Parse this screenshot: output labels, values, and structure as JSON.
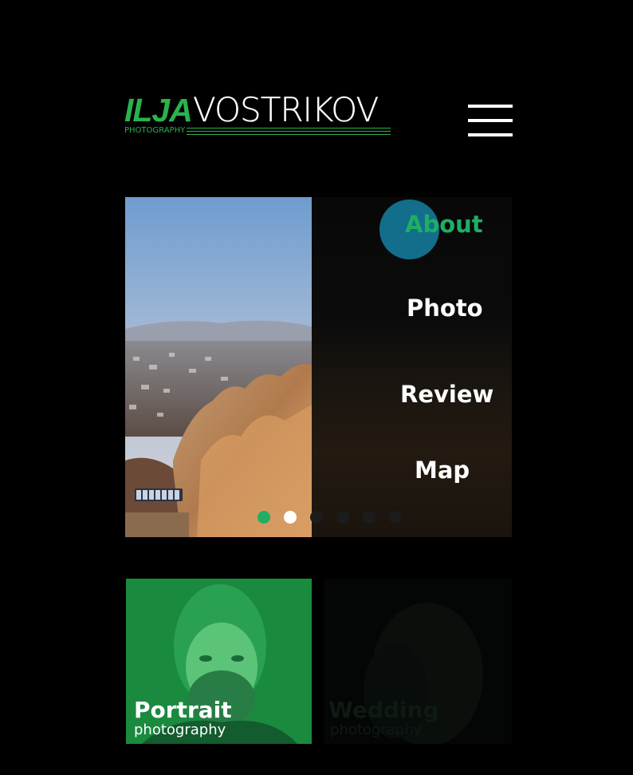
{
  "logo": {
    "first": "ILJA",
    "last": "VOSTRIKOV",
    "tagline": "PHOTOGRAPHY",
    "accent_color": "#2bb24c"
  },
  "header": {
    "menu_icon": "hamburger-menu-icon"
  },
  "hero": {
    "menu": [
      {
        "label": "About",
        "active": true
      },
      {
        "label": "Photo",
        "active": false
      },
      {
        "label": "Review",
        "active": false
      },
      {
        "label": "Map",
        "active": false
      }
    ],
    "active_color": "#1fae64",
    "ripple_color": "#147a9a",
    "slides_total": 6,
    "slide_active": 1
  },
  "tiles": [
    {
      "title": "Portrait",
      "subtitle": "photography",
      "tint": "#1a8a3e"
    },
    {
      "title": "Wedding",
      "subtitle": "photography",
      "tint": "#050807"
    }
  ]
}
